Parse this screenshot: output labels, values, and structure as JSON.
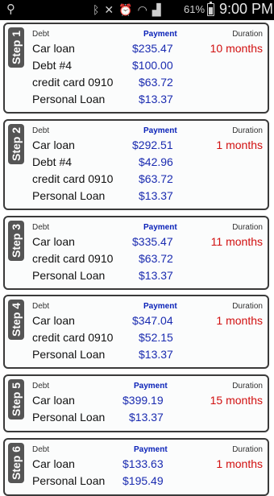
{
  "status": {
    "battery": "61%",
    "time": "9:00 PM"
  },
  "header_labels": {
    "debt": "Debt",
    "payment": "Payment",
    "duration": "Duration"
  },
  "steps": [
    {
      "label": "Step 1",
      "rows": [
        {
          "debt": "Car loan",
          "payment": "$235.47",
          "duration": "10 months"
        },
        {
          "debt": "Debt #4",
          "payment": "$100.00",
          "duration": ""
        },
        {
          "debt": "credit card 0910",
          "payment": "$63.72",
          "duration": ""
        },
        {
          "debt": "Personal Loan",
          "payment": "$13.37",
          "duration": ""
        }
      ]
    },
    {
      "label": "Step 2",
      "rows": [
        {
          "debt": "Car loan",
          "payment": "$292.51",
          "duration": "1 months"
        },
        {
          "debt": "Debt #4",
          "payment": "$42.96",
          "duration": ""
        },
        {
          "debt": "credit card 0910",
          "payment": "$63.72",
          "duration": ""
        },
        {
          "debt": "Personal Loan",
          "payment": "$13.37",
          "duration": ""
        }
      ]
    },
    {
      "label": "Step 3",
      "rows": [
        {
          "debt": "Car loan",
          "payment": "$335.47",
          "duration": "11 months"
        },
        {
          "debt": "credit card 0910",
          "payment": "$63.72",
          "duration": ""
        },
        {
          "debt": "Personal Loan",
          "payment": "$13.37",
          "duration": ""
        }
      ]
    },
    {
      "label": "Step 4",
      "rows": [
        {
          "debt": "Car loan",
          "payment": "$347.04",
          "duration": "1 months"
        },
        {
          "debt": "credit card 0910",
          "payment": "$52.15",
          "duration": ""
        },
        {
          "debt": "Personal Loan",
          "payment": "$13.37",
          "duration": ""
        }
      ]
    },
    {
      "label": "Step 5",
      "rows": [
        {
          "debt": "Car loan",
          "payment": "$399.19",
          "duration": "15 months"
        },
        {
          "debt": "Personal Loan",
          "payment": "$13.37",
          "duration": ""
        }
      ]
    },
    {
      "label": "Step 6",
      "rows": [
        {
          "debt": "Car loan",
          "payment": "$133.63",
          "duration": "1 months"
        },
        {
          "debt": "Personal Loan",
          "payment": "$195.49",
          "duration": ""
        }
      ]
    }
  ]
}
